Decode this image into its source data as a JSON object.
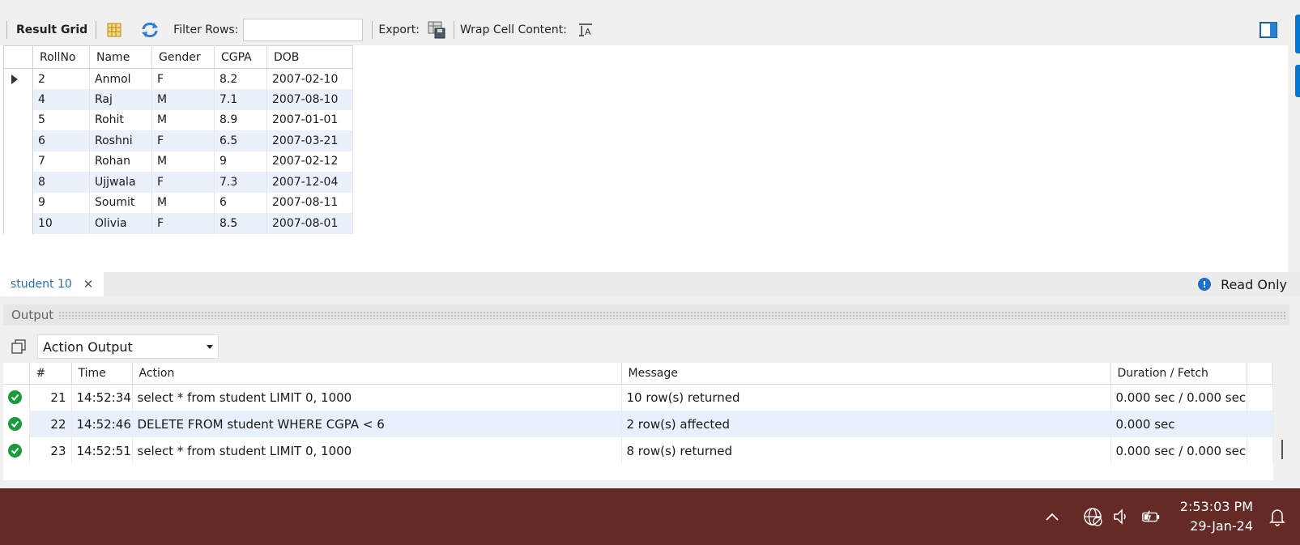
{
  "toolbar": {
    "result_grid_label": "Result Grid",
    "filter_rows_label": "Filter Rows:",
    "filter_rows_value": "",
    "export_label": "Export:",
    "wrap_label": "Wrap Cell Content:"
  },
  "result_grid": {
    "columns": [
      "RollNo",
      "Name",
      "Gender",
      "CGPA",
      "DOB"
    ],
    "rows": [
      [
        "2",
        "Anmol",
        "F",
        "8.2",
        "2007-02-10"
      ],
      [
        "4",
        "Raj",
        "M",
        "7.1",
        "2007-08-10"
      ],
      [
        "5",
        "Rohit",
        "M",
        "8.9",
        "2007-01-01"
      ],
      [
        "6",
        "Roshni",
        "F",
        "6.5",
        "2007-03-21"
      ],
      [
        "7",
        "Rohan",
        "M",
        "9",
        "2007-02-12"
      ],
      [
        "8",
        "Ujjwala",
        "F",
        "7.3",
        "2007-12-04"
      ],
      [
        "9",
        "Soumit",
        "M",
        "6",
        "2007-08-11"
      ],
      [
        "10",
        "Olivia",
        "F",
        "8.5",
        "2007-08-01"
      ]
    ]
  },
  "tabstrip": {
    "active_tab": "student 10",
    "close_symbol": "✕",
    "readonly_label": "Read Only",
    "info_symbol": "!"
  },
  "output": {
    "title": "Output",
    "selector_value": "Action Output",
    "columns": [
      "#",
      "Time",
      "Action",
      "Message",
      "Duration / Fetch"
    ],
    "rows": [
      {
        "num": "21",
        "time": "14:52:34",
        "action": "select * from student LIMIT 0, 1000",
        "message": "10 row(s) returned",
        "duration": "0.000 sec / 0.000 sec"
      },
      {
        "num": "22",
        "time": "14:52:46",
        "action": "DELETE FROM student WHERE CGPA < 6",
        "message": "2 row(s) affected",
        "duration": "0.000 sec"
      },
      {
        "num": "23",
        "time": "14:52:51",
        "action": "select * from student LIMIT 0, 1000",
        "message": "8 row(s) returned",
        "duration": "0.000 sec / 0.000 sec"
      }
    ]
  },
  "taskbar": {
    "time": "2:53:03 PM",
    "date": "29-Jan-24"
  },
  "colors": {
    "taskbar": "#652a25",
    "accent": "#0078d4",
    "success": "#1a9a3a"
  },
  "icons": [
    "grid-form-icon",
    "refresh-icon",
    "export-icon",
    "wrap-text-icon",
    "toggle-panel-icon",
    "copy-icon",
    "chevron-up-icon",
    "network-icon",
    "volume-icon",
    "battery-icon",
    "notification-bell-icon"
  ]
}
